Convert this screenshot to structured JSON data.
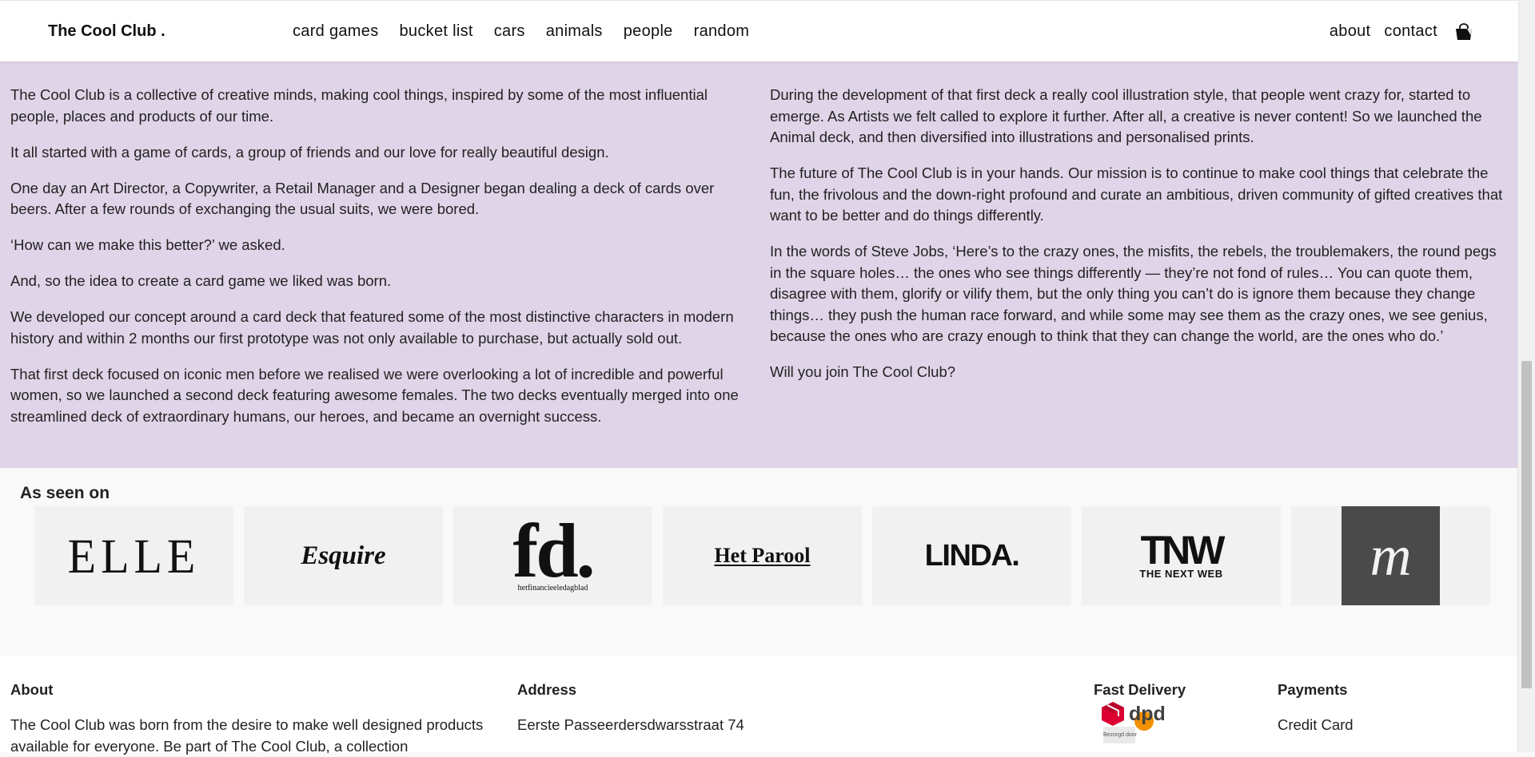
{
  "header": {
    "brand": "The Cool Club .",
    "nav": [
      "card games",
      "bucket list",
      "cars",
      "animals",
      "people",
      "random"
    ],
    "right": [
      "about",
      "contact"
    ],
    "cart_icon": "shopping-bag-icon"
  },
  "story": {
    "left": [
      "The Cool Club is a collective of creative minds, making cool things, inspired by some of the most influential people, places and products of our time.",
      "It all started with a game of cards, a group of friends and our love for really beautiful design.",
      "One day an Art Director, a Copywriter, a Retail Manager and a Designer began dealing a deck of cards over beers. After a few rounds of exchanging the usual suits, we were bored.",
      "‘How can we make this better?’ we asked.",
      "And, so the idea to create a card game we liked was born.",
      "We developed our concept around a card deck that featured some of the most distinctive characters in modern history and within 2 months our first prototype was not only available to purchase, but actually sold out.",
      "That first deck focused on iconic men before we realised we were overlooking a lot of incredible and powerful women, so we launched a second deck featuring awesome females. The two decks eventually merged into one streamlined deck of extraordinary humans, our heroes, and became an overnight success."
    ],
    "right": [
      "During the development of that first deck a really cool illustration style, that people went crazy for, started to emerge. As Artists we felt called to explore it further. After all, a creative is never content! So we launched the Animal deck, and then diversified into illustrations and personalised prints.",
      "The future of The Cool Club is in your hands. Our mission is to continue to make cool things that celebrate the fun, the frivolous and the down-right profound and curate an ambitious, driven community of gifted creatives that want to be better and do things differently.",
      "In the words of Steve Jobs, ‘Here’s to the crazy ones, the misfits, the rebels, the troublemakers, the round pegs in the square holes… the ones who see things differently — they’re not fond of rules… You can quote them, disagree with them, glorify or vilify them, but the only thing you can’t do is ignore them because they change things… they push the human race forward, and while some may see them as the crazy ones, we see genius, because the ones who are crazy enough to think that they can change the world, are the ones who do.’",
      "Will you join The Cool Club?"
    ]
  },
  "seen_on": {
    "title": "As seen on",
    "logos": {
      "elle": "ELLE",
      "esquire": "Esquire",
      "fd": "fd.",
      "fd_sub": "hetfinancieeledagblad",
      "parool": "Het Parool",
      "linda": "LINDA.",
      "tnw": "TNW",
      "tnw_sub": "THE NEXT WEB",
      "m": "m"
    }
  },
  "footer": {
    "about_title": "About",
    "about_text": "The Cool Club was born from the desire to make well designed products available for everyone. Be part of The Cool Club, a collection",
    "address_title": "Address",
    "address_line": "Eerste Passeerdersdwarsstraat 74",
    "delivery_title": "Fast Delivery",
    "delivery_logo": "dpd",
    "delivery_sub": "Bezorgd door",
    "delivery_post": "post.nl",
    "payments_title": "Payments",
    "payments_item": "Credit Card"
  },
  "colors": {
    "story_bg": "#e0d4e8",
    "dpd_red": "#dc0032",
    "postnl_orange": "#f39200"
  }
}
